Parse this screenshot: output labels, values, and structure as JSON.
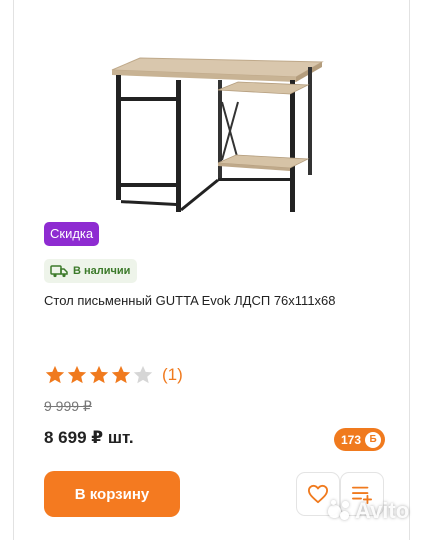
{
  "product": {
    "badge_discount": "Скидка",
    "stock_label": "В наличии",
    "title": "Стол письменный GUTTA Evok ЛДСП 76х111х68",
    "rating": {
      "stars": 4,
      "max": 5,
      "reviews_text": "(1)"
    },
    "old_price": "9 999 ₽",
    "price": "8 699 ₽ шт.",
    "bonus_points": "173",
    "bonus_symbol": "Б"
  },
  "actions": {
    "cart_label": "В корзину"
  },
  "colors": {
    "accent": "#f47a20",
    "discount": "#8e2bd1",
    "stock_bg": "#eef4ea",
    "stock_text": "#3c7a2a"
  },
  "icons": {
    "stock": "truck-icon",
    "favorite": "heart-icon",
    "list": "add-to-list-icon"
  },
  "watermark": {
    "text": "Avito"
  }
}
